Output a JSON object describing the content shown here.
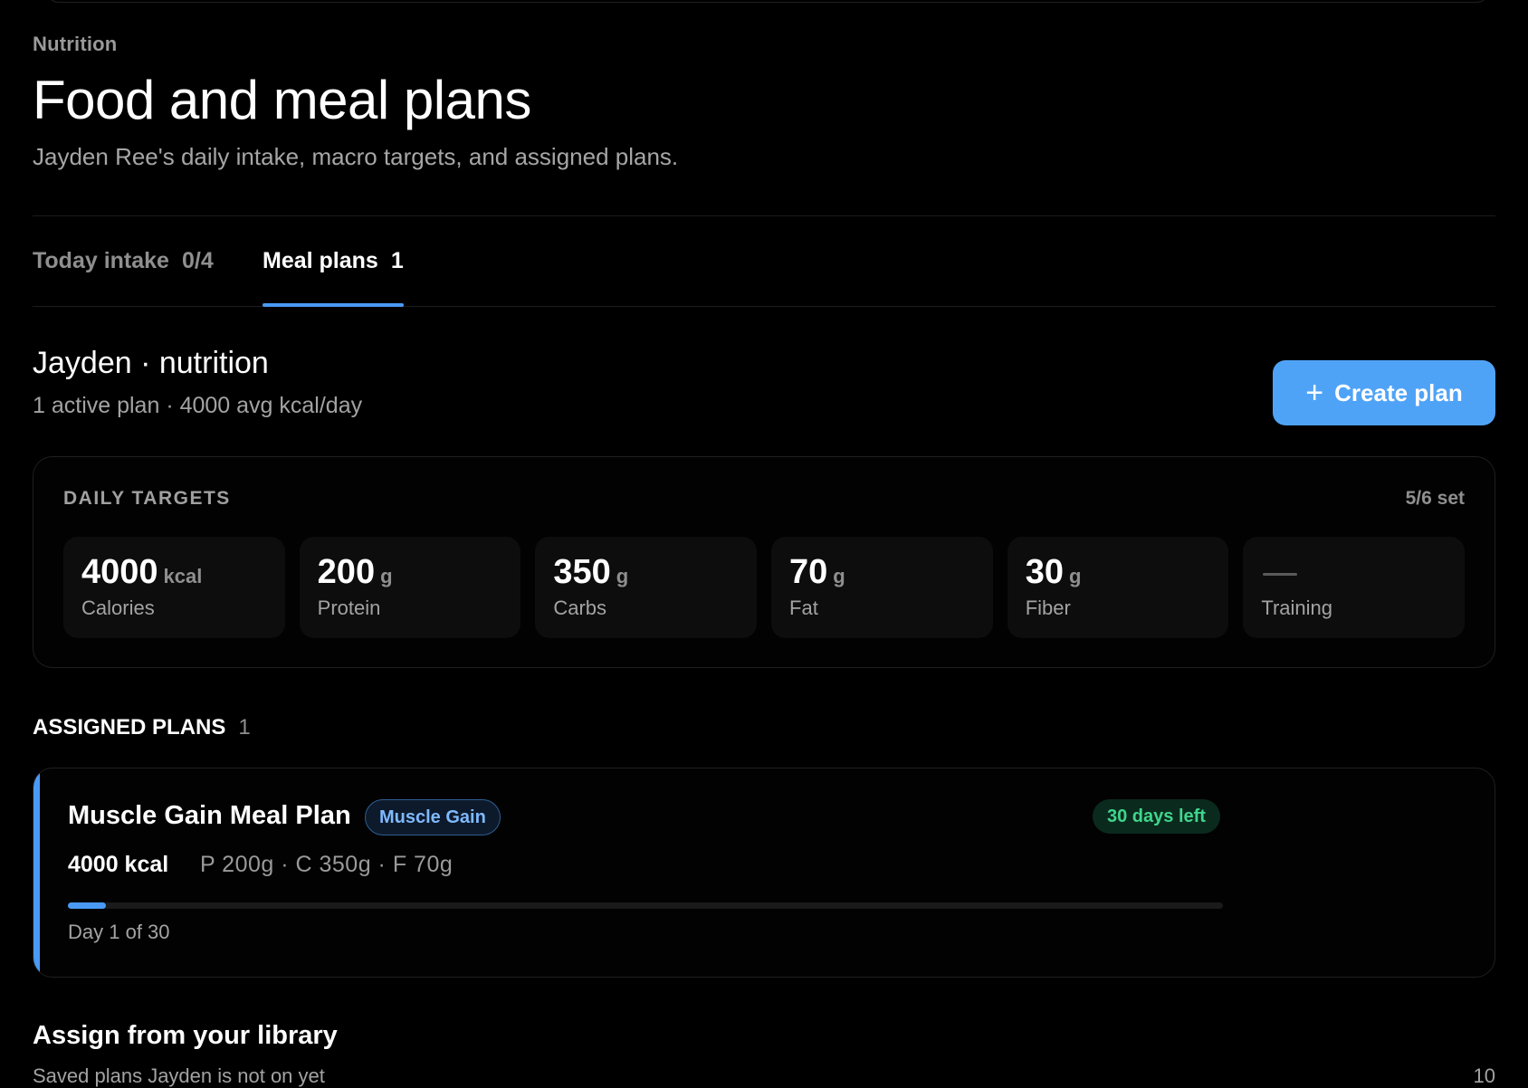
{
  "header": {
    "eyebrow": "Nutrition",
    "title": "Food and meal plans",
    "subtitle": "Jayden Ree's daily intake, macro targets, and assigned plans."
  },
  "tabs": [
    {
      "label": "Today intake",
      "count": "0/4",
      "active": false
    },
    {
      "label": "Meal plans",
      "count": "1",
      "active": true
    }
  ],
  "client": {
    "title": "Jayden · nutrition",
    "summary": "1 active plan · 4000 avg kcal/day",
    "create_label": "Create plan",
    "create_icon": "plus-icon"
  },
  "targets": {
    "label": "DAILY TARGETS",
    "count": "5/6 set",
    "items": [
      {
        "value": "4000",
        "unit": "kcal",
        "label": "Calories"
      },
      {
        "value": "200",
        "unit": "g",
        "label": "Protein"
      },
      {
        "value": "350",
        "unit": "g",
        "label": "Carbs"
      },
      {
        "value": "70",
        "unit": "g",
        "label": "Fat"
      },
      {
        "value": "30",
        "unit": "g",
        "label": "Fiber"
      },
      {
        "value": "—",
        "unit": "",
        "label": "Training"
      }
    ]
  },
  "assigned": {
    "label": "ASSIGNED PLANS",
    "count": "1",
    "plans": [
      {
        "name": "Muscle Gain Meal Plan",
        "tag": "Muscle Gain",
        "days_left": "30 days left",
        "kcal": "4000 kcal",
        "macros": "P 200g · C 350g · F 70g",
        "progress_fraction": 0.033,
        "day_label": "Day 1 of 30"
      }
    ]
  },
  "library": {
    "title": "Assign from your library",
    "subtitle": "Saved plans Jayden is not on yet",
    "count": "10"
  },
  "colors": {
    "background": "#000000",
    "accent": "#4a9af5",
    "button": "#4fa3f7",
    "tag_text": "#7fb9ff",
    "success_text": "#3fd68c",
    "success_bg": "#0b2a1e"
  }
}
